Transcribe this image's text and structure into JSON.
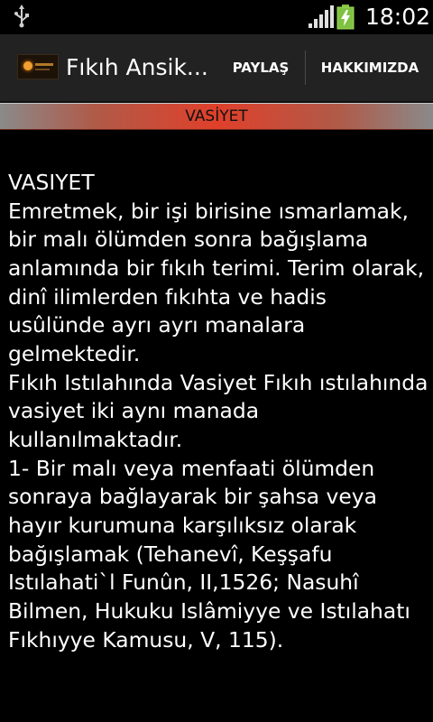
{
  "status_bar": {
    "time": "18:02",
    "icons": [
      "usb-icon",
      "signal-icon",
      "battery-charging-icon"
    ],
    "battery_color": "#7fc241"
  },
  "action_bar": {
    "title": "Fıkıh Ansik...",
    "app_icon": "app-logo-icon",
    "actions": {
      "share_label": "PAYLAŞ",
      "about_label": "HAKKIMIZDA"
    }
  },
  "header": {
    "title": "VASİYET",
    "accent_color": "#e0402a"
  },
  "content": {
    "body": "VASIYET\nEmretmek, bir işi birisine ısmarlamak, bir malı ölümden sonra bağışlama anlamında bir fıkıh terimi. Terim olarak, dinî ilimlerden fıkıhta ve hadis usûlünde ayrı ayrı manalara gelmektedir.\nFıkıh Istılahında Vasiyet Fıkıh ıstılahında vasiyet iki aynı manada kullanılmaktadır.\n1- Bir malı veya menfaati ölümden sonraya bağlayarak bir şahsa veya hayır kurumuna karşılıksız olarak bağışlamak (Tehanevî, Keşşafu Istılahati`l Funûn, II,1526; Nasuhî Bilmen, Hukuku Islâmiyye ve Istılahatı Fıkhıyye Kamusu, V, 115)."
  }
}
